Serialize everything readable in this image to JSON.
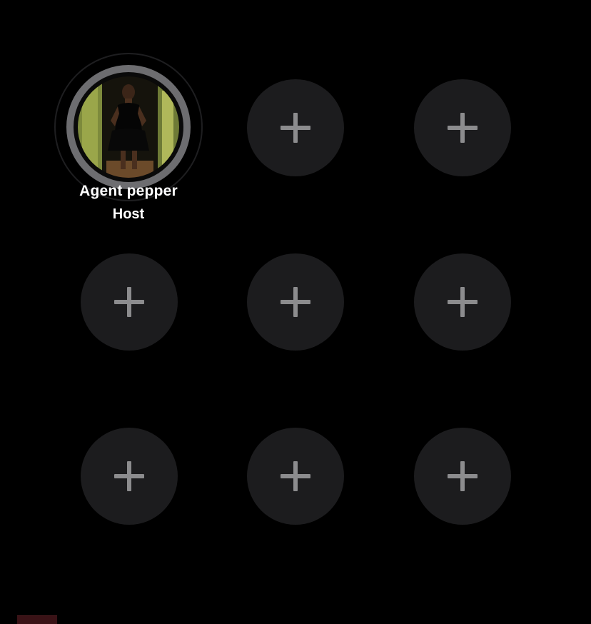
{
  "host": {
    "name": "Agent pepper",
    "role": "Host"
  },
  "seats": [
    {
      "icon": "plus-icon"
    },
    {
      "icon": "plus-icon"
    },
    {
      "icon": "plus-icon"
    },
    {
      "icon": "plus-icon"
    },
    {
      "icon": "plus-icon"
    },
    {
      "icon": "plus-icon"
    },
    {
      "icon": "plus-icon"
    },
    {
      "icon": "plus-icon"
    }
  ],
  "colors": {
    "background": "#000000",
    "seat": "#1c1c1e",
    "plus": "#8c8c8e",
    "host_ring": "#6d6d70",
    "text": "#ffffff"
  }
}
